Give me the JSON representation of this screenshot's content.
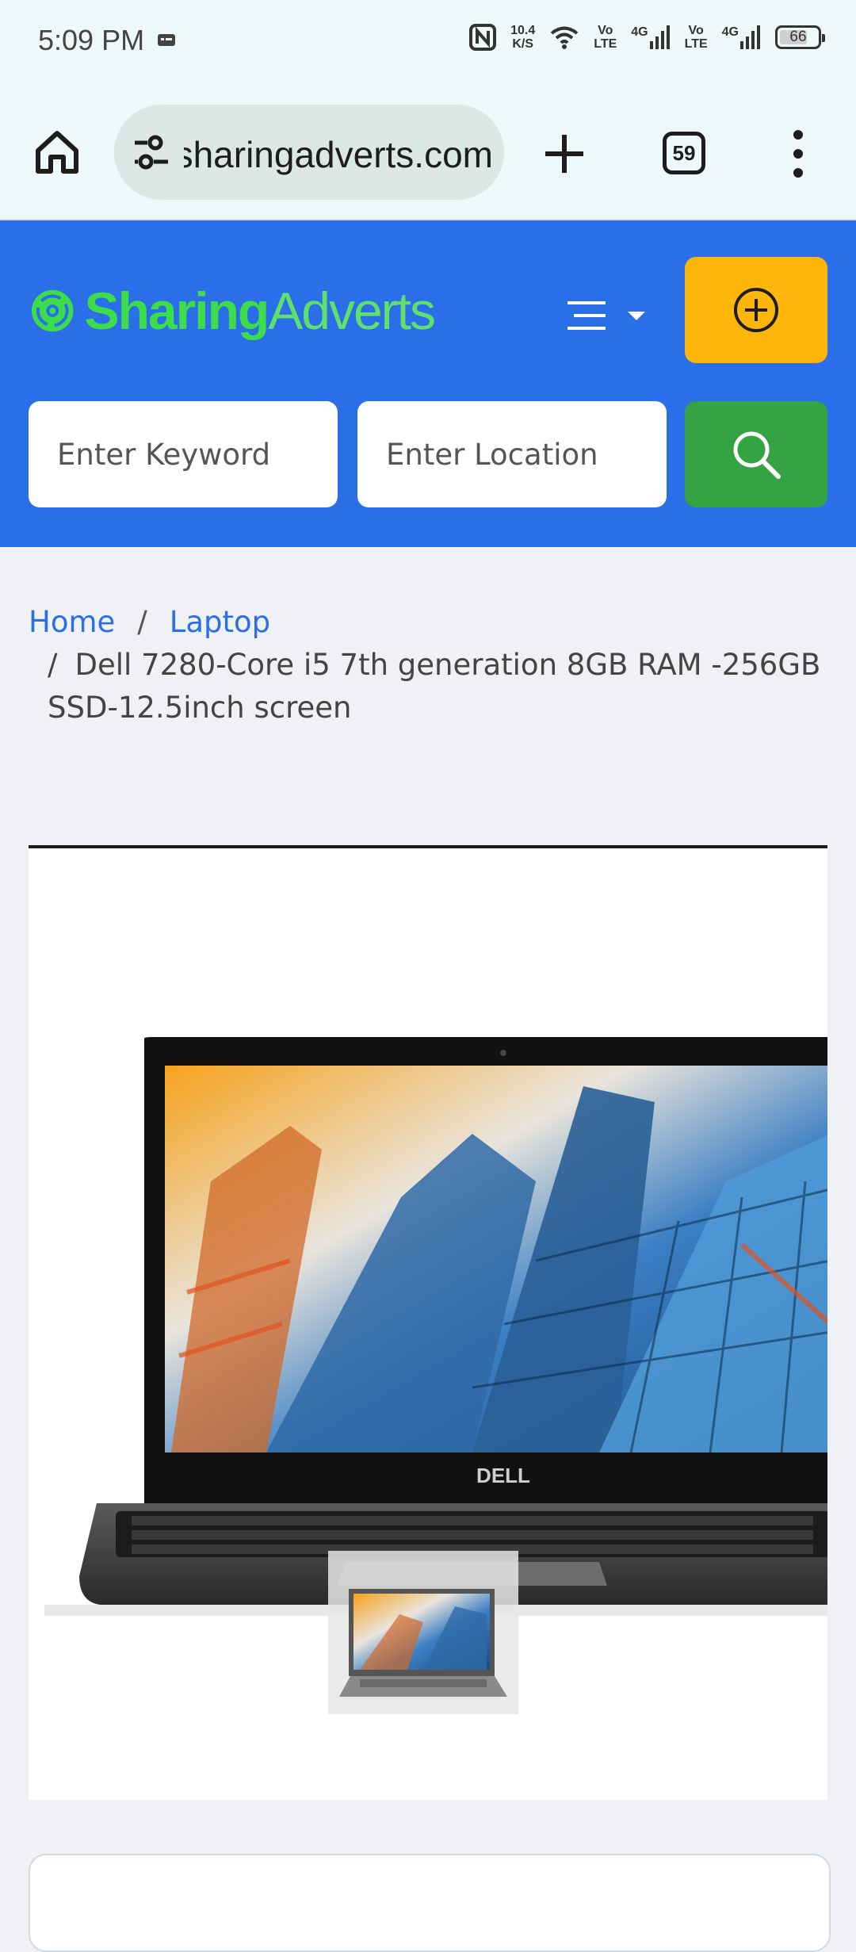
{
  "status_bar": {
    "time": "5:09 PM",
    "net_speed_value": "10.4",
    "net_speed_unit": "K/S",
    "volte1": "Vo\nLTE",
    "volte2": "Vo\nLTE",
    "network1": "4G",
    "network2": "4G",
    "battery": "66"
  },
  "browser": {
    "url": "sharingadverts.com",
    "tab_count": "59"
  },
  "site": {
    "logo_part1": "Sharing",
    "logo_part2": "Adverts",
    "keyword_placeholder": "Enter Keyword",
    "location_placeholder": "Enter Location",
    "accent_color": "#2a6ee8",
    "post_button_color": "#ffb60a",
    "search_button_color": "#33a344"
  },
  "breadcrumb": {
    "home": "Home",
    "category": "Laptop",
    "current": "Dell 7280-Core i5 7th generation 8GB RAM -256GB SSD-12.5inch screen"
  },
  "gallery": {
    "brand_on_device": "DELL"
  }
}
